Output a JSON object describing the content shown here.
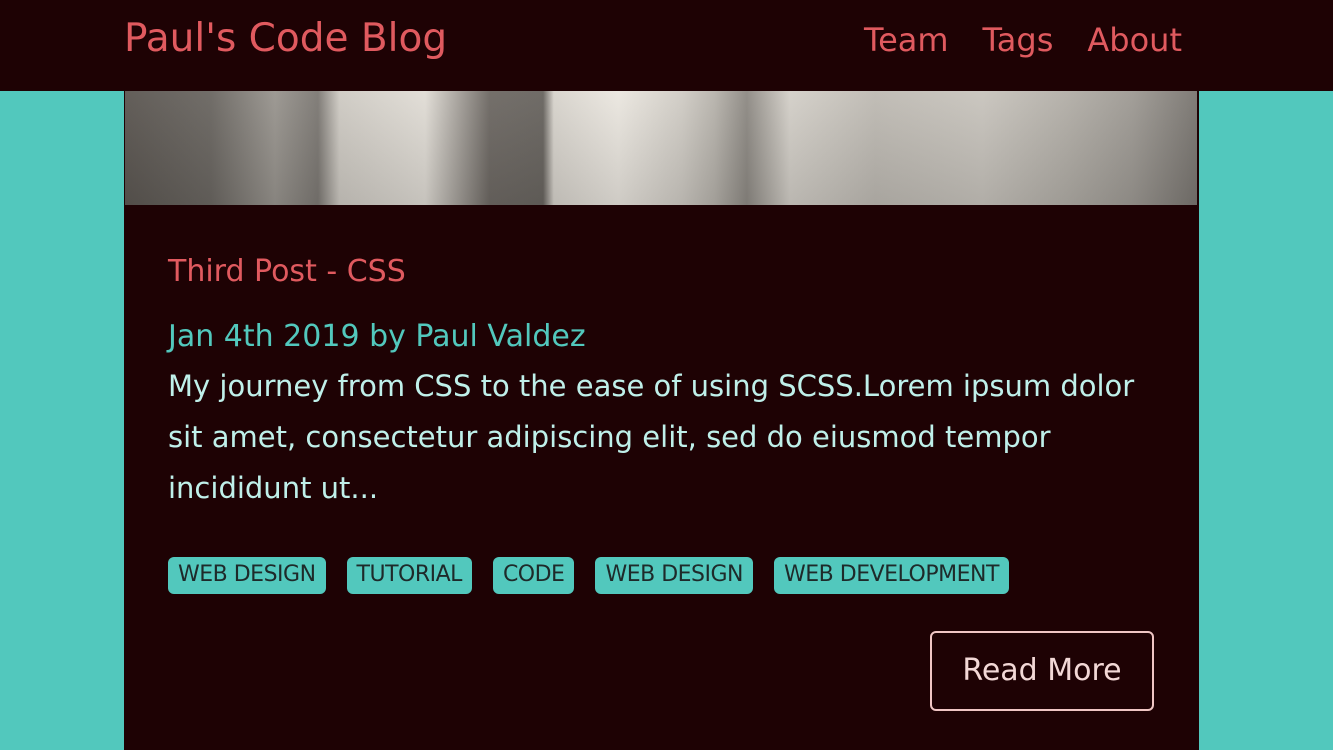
{
  "nav": {
    "brand": "Paul's Code Blog",
    "links": [
      "Team",
      "Tags",
      "About"
    ]
  },
  "post": {
    "title": "Third Post - CSS",
    "meta": "Jan 4th 2019 by Paul Valdez",
    "excerpt": "My journey from CSS to the ease of using SCSS.Lorem ipsum dolor sit amet, consectetur adipiscing elit, sed do eiusmod tempor incididunt ut...",
    "tags": [
      "WEB DESIGN",
      "TUTORIAL",
      "CODE",
      "WEB DESIGN",
      "WEB DEVELOPMENT"
    ],
    "read_more_label": "Read More"
  },
  "colors": {
    "background": "#52c8bd",
    "surface": "#1e0204",
    "accent_red": "#e05a5f",
    "accent_teal": "#52c8bd"
  }
}
